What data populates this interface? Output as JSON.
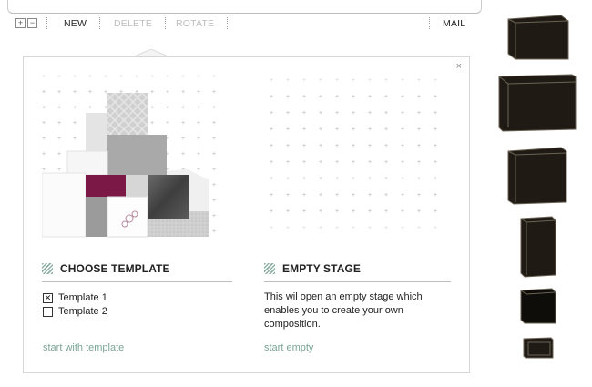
{
  "toolbar": {
    "zoom_in": "+",
    "zoom_out": "−",
    "new_label": "NEW",
    "delete_label": "DELETE",
    "rotate_label": "ROTATE",
    "mail_label": "MAIL"
  },
  "dialog": {
    "close": "×",
    "template": {
      "heading": "CHOOSE TEMPLATE",
      "options": [
        {
          "label": "Template 1",
          "checked": true
        },
        {
          "label": "Template 2",
          "checked": false
        }
      ],
      "action": "start with template"
    },
    "empty": {
      "heading": "EMPTY STAGE",
      "description": "This wil open an empty stage which enables you to create your own composition.",
      "action": "start empty"
    }
  },
  "colors": {
    "accent": "#7aa596",
    "shelf_dark": "#1f1a14",
    "magenta": "#7b1845",
    "disabled": "#bdbdbd"
  },
  "shelves": [
    "shelf-1",
    "shelf-2",
    "shelf-3",
    "shelf-4",
    "shelf-5",
    "shelf-6"
  ]
}
